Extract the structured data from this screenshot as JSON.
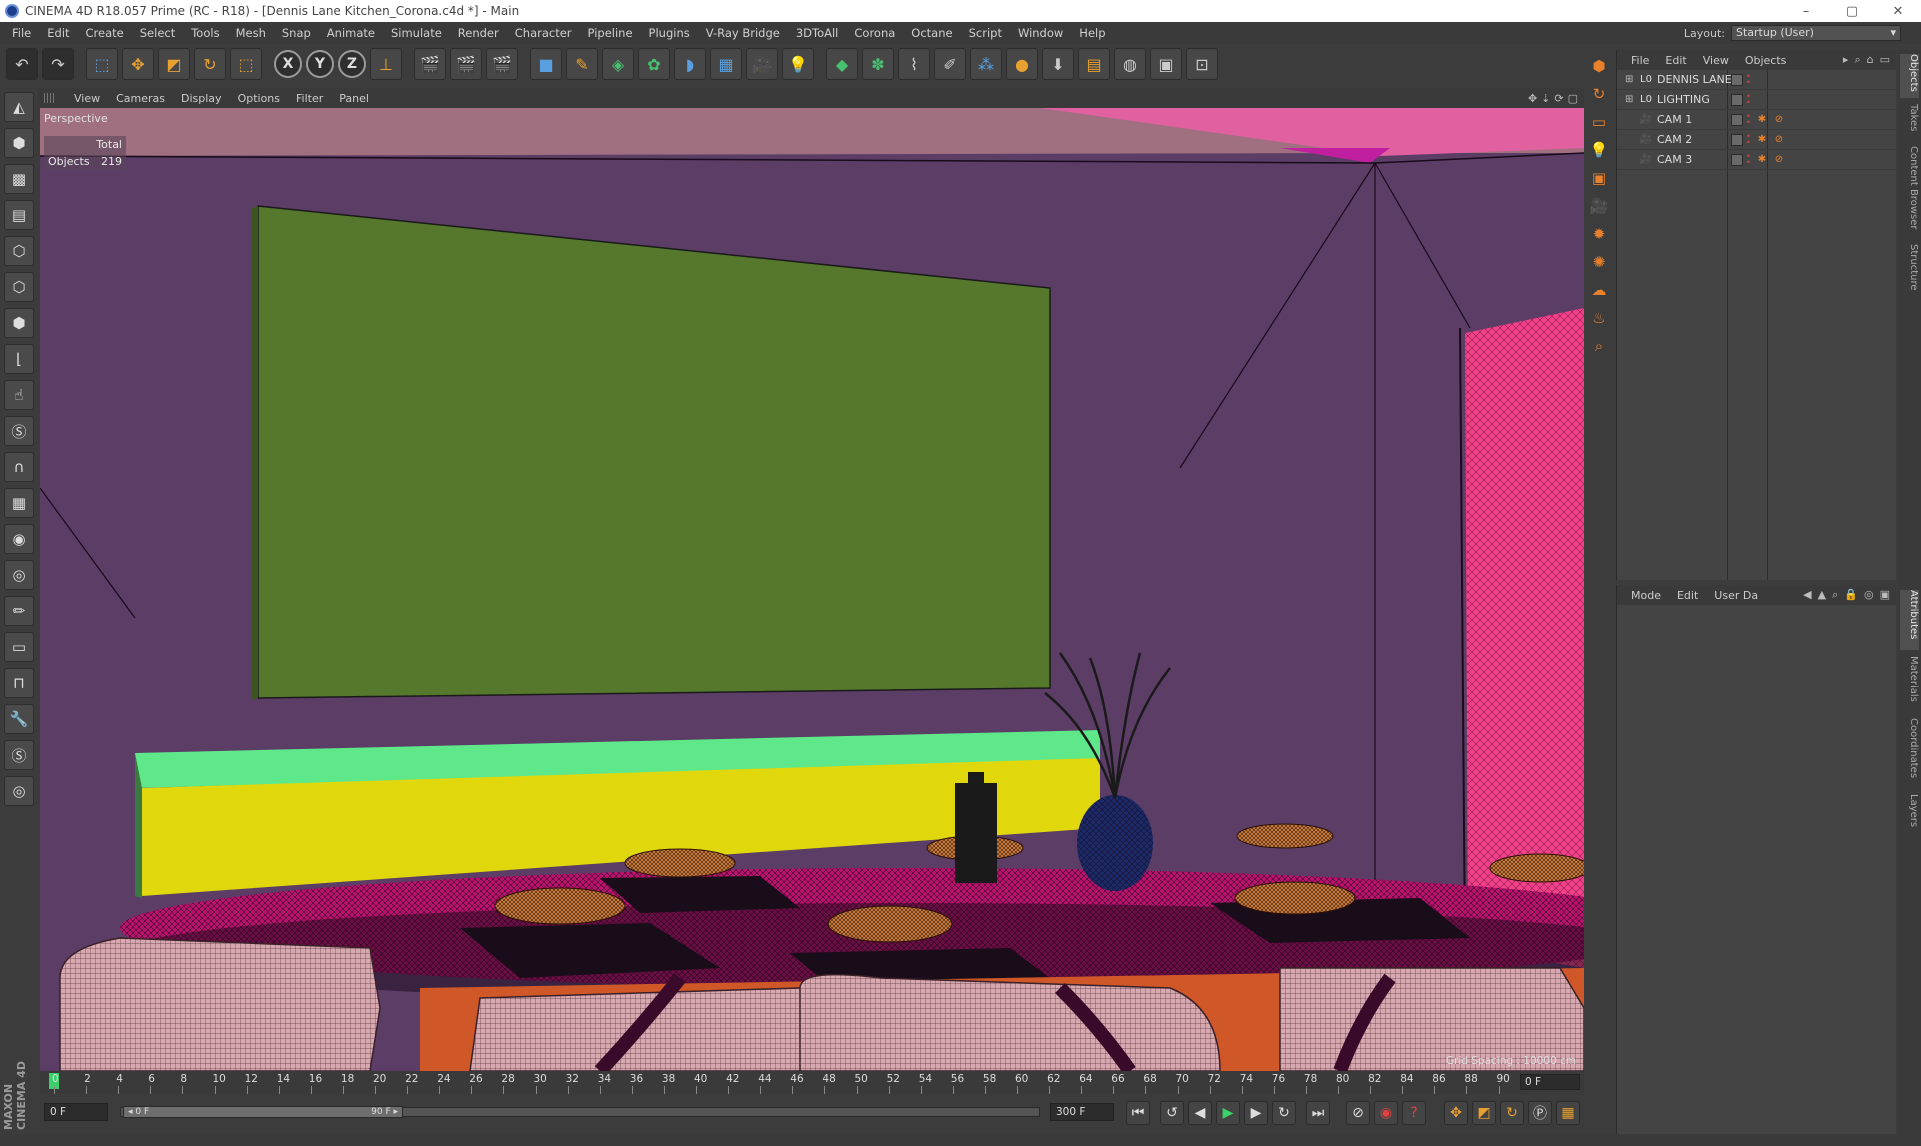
{
  "window": {
    "title": "CINEMA 4D R18.057 Prime (RC - R18) - [Dennis Lane Kitchen_Corona.c4d *] - Main",
    "controls": [
      "–",
      "▢",
      "✕"
    ]
  },
  "menu": {
    "items": [
      "File",
      "Edit",
      "Create",
      "Select",
      "Tools",
      "Mesh",
      "Snap",
      "Animate",
      "Simulate",
      "Render",
      "Character",
      "Pipeline",
      "Plugins",
      "V-Ray Bridge",
      "3DToAll",
      "Corona",
      "Octane",
      "Script",
      "Window",
      "Help"
    ],
    "layout_label": "Layout:",
    "layout_value": "Startup (User)"
  },
  "toolbar": {
    "icons": [
      "undo-icon",
      "redo-icon",
      "live-selection-icon",
      "move-icon",
      "scale-icon",
      "rotate-icon",
      "last-tool-icon",
      "x-axis-icon",
      "y-axis-icon",
      "z-axis-icon",
      "world-coord-icon",
      "render-view-icon",
      "render-picture-viewer-icon",
      "edit-render-settings-icon",
      "cube-icon",
      "pen-icon",
      "subdivision-icon",
      "array-icon",
      "deformer-icon",
      "floor-icon",
      "camera-icon",
      "light-icon",
      "tag-icon",
      "mograph-icon",
      "hair-icon",
      "sketch-icon",
      "particles-icon",
      "orange-ball-icon",
      "download-icon",
      "texture-icon",
      "color-wheel-icon",
      "picture-icon",
      "layer-icon"
    ],
    "axis_labels": [
      "X",
      "Y",
      "Z"
    ]
  },
  "left_tools": [
    "make-editable-icon",
    "model-mode-icon",
    "texture-mode-icon",
    "workplane-icon",
    "points-mode-icon",
    "edges-mode-icon",
    "polygons-mode-icon",
    "axis-mode-icon",
    "tweak-icon",
    "solo-icon",
    "magnet-icon",
    "brush-icon",
    "sculpt-icon",
    "paint-icon",
    "stencil-icon",
    "grid-icon",
    "snap-icon",
    "tools-icon",
    "spline-icon",
    "spiral-icon"
  ],
  "brand": "MAXON CINEMA 4D",
  "viewport": {
    "menu": [
      "View",
      "Cameras",
      "Display",
      "Options",
      "Filter",
      "Panel"
    ],
    "label": "Perspective",
    "stats_header": "Total",
    "stats_row_label": "Objects",
    "stats_row_value": "219",
    "grid_spacing": "Grid Spacing : 10000 cm"
  },
  "object_manager": {
    "menu": [
      "File",
      "Edit",
      "View",
      "Objects"
    ],
    "rows": [
      {
        "name": "DENNIS LANE",
        "icon": "null-icon"
      },
      {
        "name": "LIGHTING",
        "icon": "null-icon"
      },
      {
        "name": "CAM 1",
        "icon": "camera-icon"
      },
      {
        "name": "CAM 2",
        "icon": "camera-icon"
      },
      {
        "name": "CAM 3",
        "icon": "camera-icon"
      }
    ]
  },
  "attributes": {
    "menu": [
      "Mode",
      "Edit",
      "User Da"
    ]
  },
  "right_tabs": [
    "Objects",
    "Takes",
    "Content Browser",
    "Structure",
    "Attributes",
    "Materials",
    "Coordinates",
    "Layers"
  ],
  "timeline": {
    "ticks": [
      "0",
      "2",
      "4",
      "6",
      "8",
      "10",
      "12",
      "14",
      "16",
      "18",
      "20",
      "22",
      "24",
      "26",
      "28",
      "30",
      "32",
      "34",
      "36",
      "38",
      "40",
      "42",
      "44",
      "46",
      "48",
      "50",
      "52",
      "54",
      "56",
      "58",
      "60",
      "62",
      "64",
      "66",
      "68",
      "70",
      "72",
      "74",
      "76",
      "78",
      "80",
      "82",
      "84",
      "86",
      "88",
      "90"
    ],
    "current_frame": "0 F"
  },
  "transport": {
    "start_field": "0 F",
    "range_start": "◂ 0 F",
    "range_end": "90 F ▸",
    "end_field": "300 F"
  },
  "colors": {
    "viewport_bg": "#5b3d66",
    "accent_orange": "#e8802c",
    "current_frame_green": "#3bd16a"
  }
}
